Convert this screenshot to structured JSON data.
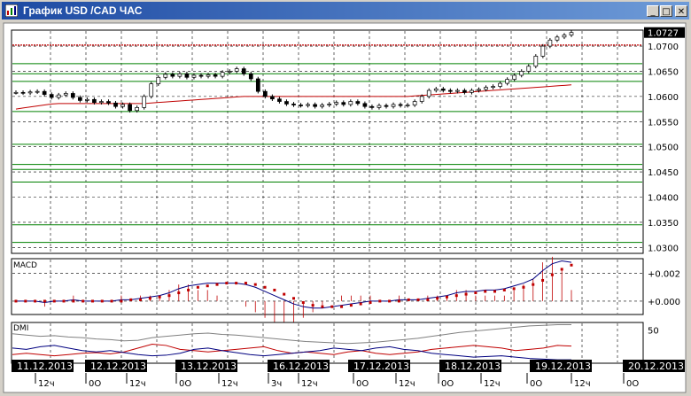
{
  "window": {
    "title": "График USD /CAD  ЧАС",
    "buttons": {
      "minimize": "_",
      "maximize": "□",
      "close": "✕"
    },
    "title_color": "#1d4aa3"
  },
  "chart_data": [
    {
      "type": "candlestick",
      "title": "График USD /CAD  ЧАС",
      "ylim": [
        1.029,
        1.073
      ],
      "y_ticks": [
        "1.0700",
        "1.0650",
        "1.0600",
        "1.0550",
        "1.0500",
        "1.0450",
        "1.0400",
        "1.0350",
        "1.0300"
      ],
      "current_price": "1.0727",
      "grid": true,
      "colors": {
        "candle": "#000000",
        "ma": "#c00000",
        "support_lines": "#008000",
        "level_line": "#c00000",
        "current_marker": "#000000"
      },
      "close_series": [
        1.0608,
        1.0607,
        1.0609,
        1.061,
        1.0604,
        1.0598,
        1.0603,
        1.0606,
        1.0598,
        1.0592,
        1.0594,
        1.0588,
        1.059,
        1.0587,
        1.058,
        1.0584,
        1.0572,
        1.0578,
        1.06,
        1.0625,
        1.0638,
        1.0644,
        1.064,
        1.0645,
        1.0638,
        1.0642,
        1.064,
        1.0643,
        1.064,
        1.0648,
        1.065,
        1.0655,
        1.0645,
        1.0635,
        1.061,
        1.06,
        1.0595,
        1.059,
        1.0585,
        1.0583,
        1.0582,
        1.0584,
        1.058,
        1.0583,
        1.0585,
        1.0588,
        1.0584,
        1.059,
        1.0586,
        1.058,
        1.0578,
        1.0582,
        1.058,
        1.0584,
        1.0582,
        1.0583,
        1.059,
        1.06,
        1.0612,
        1.0615,
        1.0612,
        1.061,
        1.0612,
        1.0608,
        1.0612,
        1.0614,
        1.0618,
        1.062,
        1.0626,
        1.0634,
        1.0642,
        1.065,
        1.066,
        1.068,
        1.07,
        1.0712,
        1.0718,
        1.0722,
        1.0727
      ],
      "ma_series": [
        1.0575,
        1.0577,
        1.0579,
        1.0581,
        1.0583,
        1.0585,
        1.0586,
        1.0586,
        1.0586,
        1.0586,
        1.0586,
        1.0586,
        1.0586,
        1.0586,
        1.0586,
        1.0586,
        1.0586,
        1.0586,
        1.0586,
        1.0587,
        1.0588,
        1.0589,
        1.059,
        1.0591,
        1.0592,
        1.0593,
        1.0594,
        1.0595,
        1.0596,
        1.0597,
        1.0598,
        1.0599,
        1.06,
        1.06,
        1.06,
        1.06,
        1.06,
        1.06,
        1.06,
        1.06,
        1.06,
        1.06,
        1.06,
        1.06,
        1.06,
        1.06,
        1.06,
        1.06,
        1.06,
        1.06,
        1.06,
        1.06,
        1.06,
        1.06,
        1.06,
        1.06,
        1.0601,
        1.0602,
        1.0603,
        1.0604,
        1.0605,
        1.0606,
        1.0607,
        1.0608,
        1.0609,
        1.061,
        1.0611,
        1.0612,
        1.0613,
        1.0614,
        1.0615,
        1.0616,
        1.0617,
        1.0618,
        1.0619,
        1.062,
        1.0621,
        1.0622,
        1.0623
      ],
      "green_levels": [
        1.0665,
        1.0645,
        1.063,
        1.057,
        1.0505,
        1.0465,
        1.0455,
        1.043,
        1.0345,
        1.031
      ],
      "red_levels": [
        1.0702
      ]
    },
    {
      "type": "line",
      "name": "MACD",
      "title": "MACD",
      "ylim": [
        -0.0009,
        0.003
      ],
      "y_ticks": [
        "+0.002",
        "+0.000"
      ],
      "tick_values": [
        0.002,
        0.0
      ],
      "colors": {
        "macd": "#000080",
        "signal": "#c00000",
        "histogram": "#c00000"
      },
      "macd_series": [
        0.0,
        0.0,
        0.0,
        -0.0001,
        0.0,
        0.0,
        0.0001,
        0.0,
        0.0,
        0.0,
        0.0,
        0.0001,
        0.0001,
        0.0002,
        0.0003,
        0.0004,
        0.0006,
        0.0009,
        0.0011,
        0.0012,
        0.0013,
        0.0013,
        0.0013,
        0.0013,
        0.0012,
        0.001,
        0.0007,
        0.0004,
        0.0001,
        -0.0002,
        -0.0004,
        -0.0005,
        -0.0005,
        -0.0004,
        -0.0003,
        -0.0002,
        -0.0001,
        0.0,
        0.0,
        0.0,
        0.0001,
        0.0001,
        0.0001,
        0.0002,
        0.0003,
        0.0004,
        0.0006,
        0.0007,
        0.0007,
        0.0008,
        0.0008,
        0.0009,
        0.0011,
        0.0013,
        0.0016,
        0.0022,
        0.0027,
        0.0029,
        0.0028
      ],
      "signal_series": [
        0.0,
        0.0,
        0.0,
        0.0,
        0.0,
        0.0,
        0.0,
        0.0,
        0.0,
        0.0,
        0.0,
        0.0,
        0.0001,
        0.0001,
        0.0002,
        0.0003,
        0.0004,
        0.0006,
        0.0008,
        0.001,
        0.0011,
        0.0012,
        0.0013,
        0.0013,
        0.0013,
        0.0012,
        0.001,
        0.0008,
        0.0005,
        0.0002,
        -0.0001,
        -0.0003,
        -0.0004,
        -0.0004,
        -0.0004,
        -0.0003,
        -0.0002,
        -0.0001,
        0.0,
        0.0,
        0.0,
        0.0001,
        0.0001,
        0.0001,
        0.0002,
        0.0003,
        0.0004,
        0.0005,
        0.0006,
        0.0007,
        0.0007,
        0.0008,
        0.0009,
        0.001,
        0.0012,
        0.0015,
        0.0019,
        0.0023,
        0.0026
      ]
    },
    {
      "type": "line",
      "name": "DMI",
      "title": "DMI",
      "ylim": [
        0,
        60
      ],
      "y_ticks": [
        "50"
      ],
      "tick_values": [
        50
      ],
      "colors": {
        "adx": "#808080",
        "plus_di": "#c00000",
        "minus_di": "#000080"
      },
      "adx_series": [
        44,
        42,
        40,
        41,
        39,
        38,
        36,
        35,
        33,
        34,
        38,
        40,
        42,
        44,
        45,
        43,
        42,
        40,
        38,
        36,
        34,
        32,
        31,
        30,
        29,
        30,
        31,
        33,
        35,
        37,
        40,
        43,
        46,
        48,
        50,
        52,
        54,
        56,
        57,
        58,
        58
      ],
      "plus_di_series": [
        12,
        14,
        12,
        10,
        12,
        14,
        15,
        13,
        16,
        22,
        28,
        26,
        20,
        18,
        16,
        18,
        20,
        22,
        24,
        18,
        14,
        16,
        14,
        12,
        16,
        18,
        14,
        12,
        14,
        16,
        20,
        22,
        24,
        26,
        24,
        22,
        18,
        20,
        22,
        26,
        25
      ],
      "minus_di_series": [
        22,
        20,
        24,
        26,
        22,
        18,
        16,
        18,
        15,
        12,
        10,
        11,
        14,
        20,
        22,
        18,
        15,
        12,
        10,
        12,
        14,
        16,
        18,
        22,
        20,
        18,
        22,
        24,
        20,
        18,
        14,
        12,
        10,
        8,
        9,
        10,
        8,
        6,
        5,
        4,
        4
      ]
    }
  ],
  "x_axis": {
    "dates": [
      "11.12.2013",
      "12.12.2013",
      "13.12.2013",
      "16.12.2013",
      "17.12.2013",
      "18.12.2013",
      "19.12.2013",
      "20.12.2013"
    ],
    "hours": [
      "12ч",
      "0О",
      "12ч",
      "0О",
      "12ч",
      "3ч",
      "12ч",
      "0О",
      "12ч",
      "0О",
      "12ч",
      "0О",
      "12ч",
      "0О"
    ]
  }
}
